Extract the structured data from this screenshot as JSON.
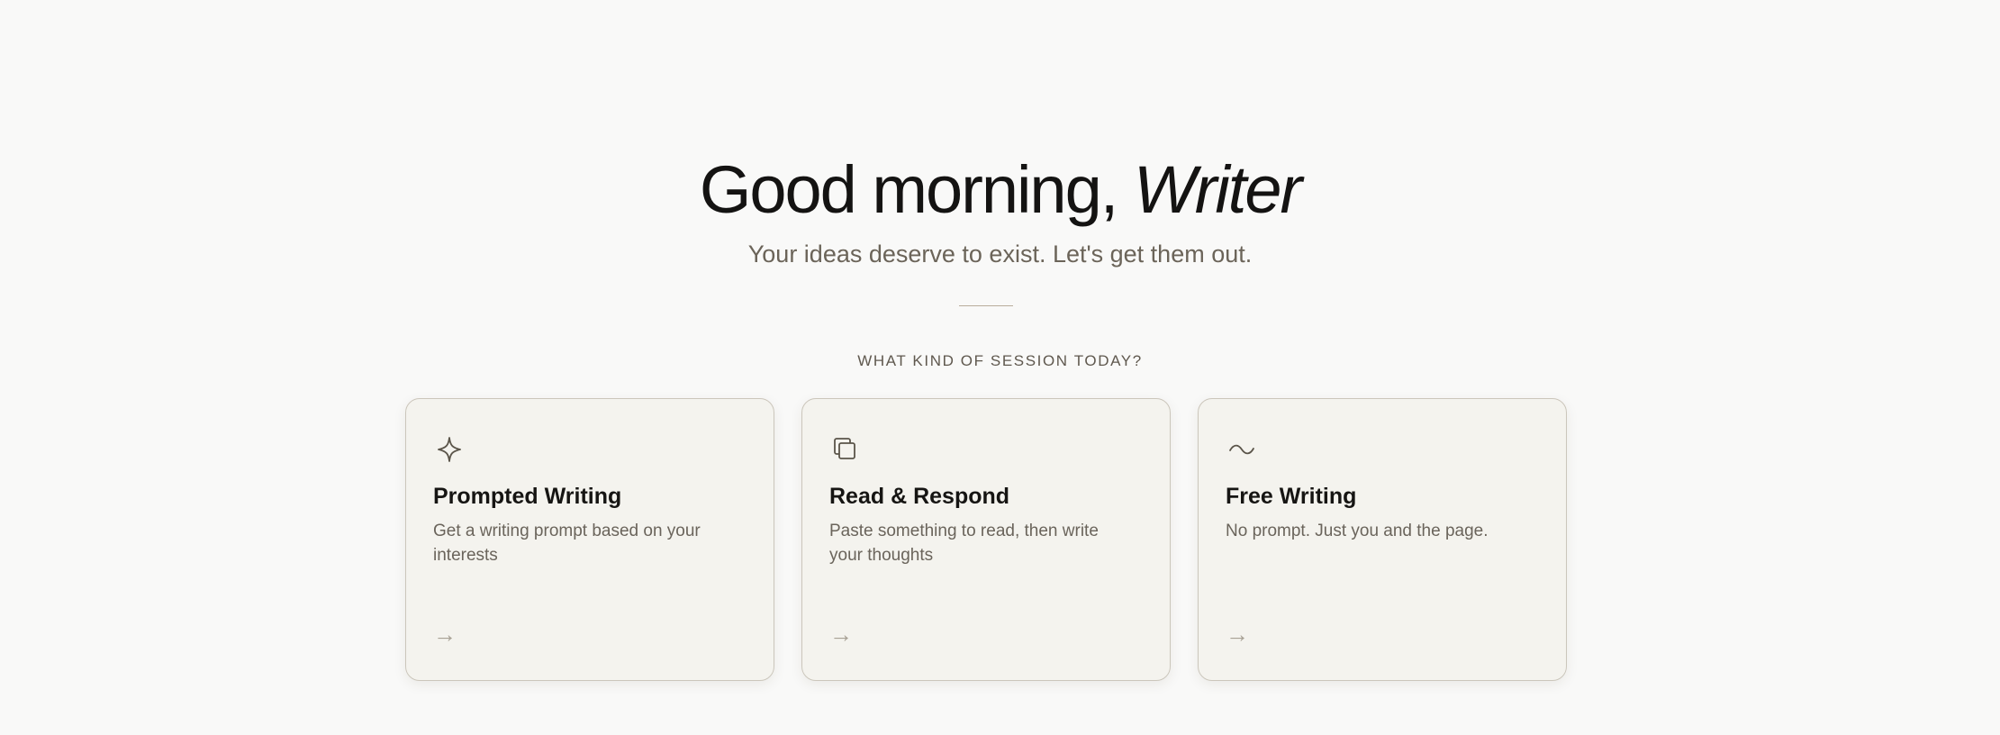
{
  "greeting": {
    "prefix": "Good morning,",
    "name": "Writer"
  },
  "tagline": "Your ideas deserve to exist. Let's get them out.",
  "section_label": "WHAT KIND OF SESSION TODAY?",
  "cards": [
    {
      "icon": "sparkle-icon",
      "title": "Prompted Writing",
      "description": "Get a writing prompt based on your interests",
      "arrow": "→"
    },
    {
      "icon": "copy-icon",
      "title": "Read & Respond",
      "description": "Paste something to read, then write your thoughts",
      "arrow": "→"
    },
    {
      "icon": "wave-icon",
      "title": "Free Writing",
      "description": "No prompt. Just you and the page.",
      "arrow": "→"
    }
  ],
  "colors": {
    "background": "#f9f9f8",
    "card_background": "#f4f3ee",
    "card_border": "#cbc6bb",
    "text_primary": "#161513",
    "text_secondary": "#6a645b",
    "divider": "#b9ad9c"
  }
}
